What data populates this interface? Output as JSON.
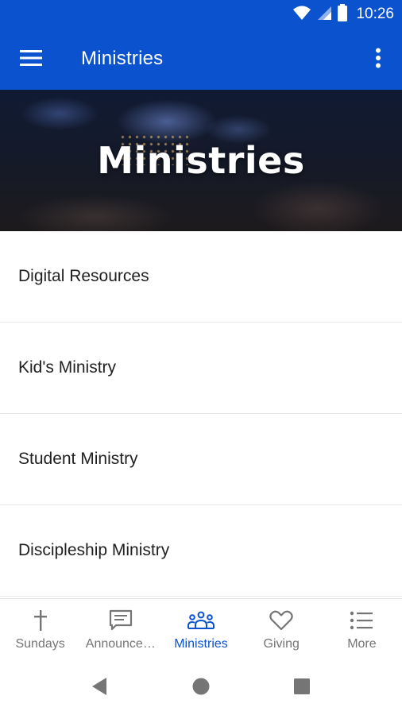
{
  "status_bar": {
    "time": "10:26",
    "icons": [
      "wifi-icon",
      "signal-icon",
      "battery-icon"
    ],
    "color": "#0b52cf"
  },
  "app_bar": {
    "title": "Ministries",
    "left_icon": "hamburger-menu-icon",
    "right_icon": "more-vert-icon",
    "color": "#0b52cf"
  },
  "hero": {
    "title": "Ministries"
  },
  "list": {
    "items": [
      {
        "label": "Digital Resources"
      },
      {
        "label": "Kid's Ministry"
      },
      {
        "label": "Student Ministry"
      },
      {
        "label": "Discipleship Ministry"
      }
    ]
  },
  "bottom_nav": {
    "active_color": "#0b52cf",
    "inactive_color": "#757575",
    "items": [
      {
        "label": "Sundays",
        "icon": "cross-icon",
        "active": false
      },
      {
        "label": "Announce…",
        "icon": "chat-icon",
        "active": false
      },
      {
        "label": "Ministries",
        "icon": "people-icon",
        "active": true
      },
      {
        "label": "Giving",
        "icon": "heart-icon",
        "active": false
      },
      {
        "label": "More",
        "icon": "list-icon",
        "active": false
      }
    ]
  },
  "system_nav": {
    "icons": [
      "back-icon",
      "home-icon",
      "recents-icon"
    ]
  }
}
